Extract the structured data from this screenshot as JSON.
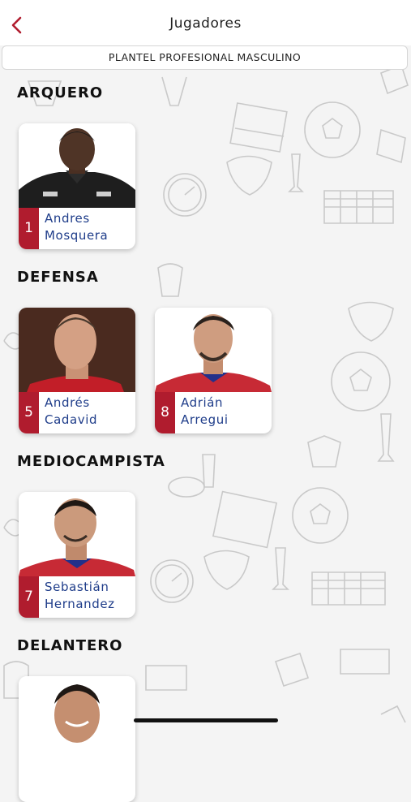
{
  "header": {
    "title": "Jugadores",
    "back_icon": "chevron-left-icon",
    "accent_color": "#b01c2e"
  },
  "segment": {
    "label": "PLANTEL PROFESIONAL MASCULINO"
  },
  "sections": [
    {
      "title": "ARQUERO",
      "players": [
        {
          "number": "1",
          "first_name": "Andres",
          "last_name": "Mosquera",
          "jersey": "black"
        }
      ]
    },
    {
      "title": "DEFENSA",
      "players": [
        {
          "number": "5",
          "first_name": "Andrés",
          "last_name": "Cadavid",
          "jersey": "red"
        },
        {
          "number": "8",
          "first_name": "Adrián",
          "last_name": "Arregui",
          "jersey": "red-blue"
        }
      ]
    },
    {
      "title": "MEDIOCAMPISTA",
      "players": [
        {
          "number": "7",
          "first_name": "Sebastián",
          "last_name": "Hernandez",
          "jersey": "red-blue"
        }
      ]
    },
    {
      "title": "DELANTERO",
      "players": [
        {
          "number": "",
          "first_name": "",
          "last_name": "",
          "jersey": ""
        }
      ]
    }
  ],
  "colors": {
    "number_badge": "#b01c2e",
    "player_name": "#1f3d8a"
  }
}
